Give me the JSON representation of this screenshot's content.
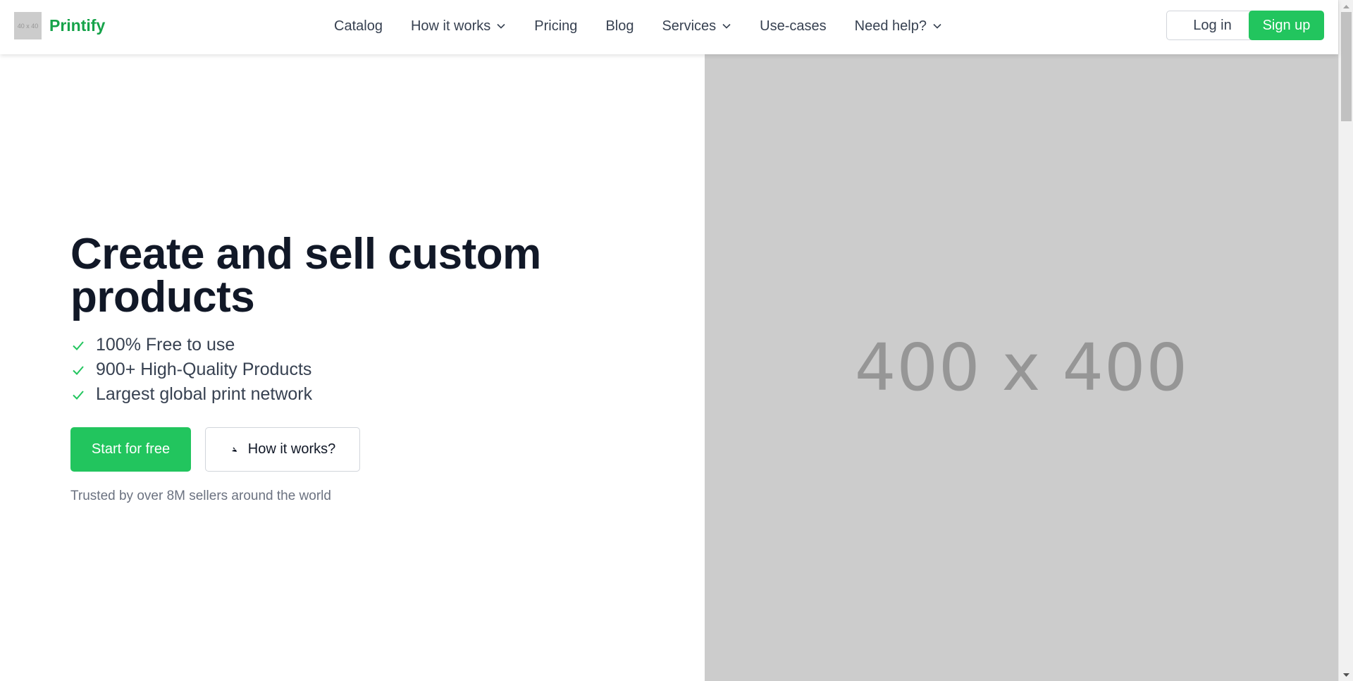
{
  "header": {
    "logo_placeholder": "40 x 40",
    "brand": "Printify",
    "nav": [
      {
        "label": "Catalog",
        "dropdown": false
      },
      {
        "label": "How it works",
        "dropdown": true
      },
      {
        "label": "Pricing",
        "dropdown": false
      },
      {
        "label": "Blog",
        "dropdown": false
      },
      {
        "label": "Services",
        "dropdown": true
      },
      {
        "label": "Use-cases",
        "dropdown": false
      },
      {
        "label": "Need help?",
        "dropdown": true
      }
    ],
    "login_label": "Log in",
    "signup_label": "Sign up"
  },
  "hero": {
    "title": "Create and sell custom products",
    "features": [
      "100% Free to use",
      "900+ High-Quality Products",
      "Largest global print network"
    ],
    "start_label": "Start for free",
    "how_label": "How it works?",
    "trusted_text": "Trusted by over 8M sellers around the world",
    "image_placeholder": "400 x 400"
  },
  "colors": {
    "accent": "#22c55e",
    "brand": "#16a34a",
    "heading": "#111827",
    "placeholder_bg": "#cccccc"
  },
  "icons": {
    "check": "check-icon",
    "chevron": "chevron-down-icon",
    "play": "play-icon"
  }
}
